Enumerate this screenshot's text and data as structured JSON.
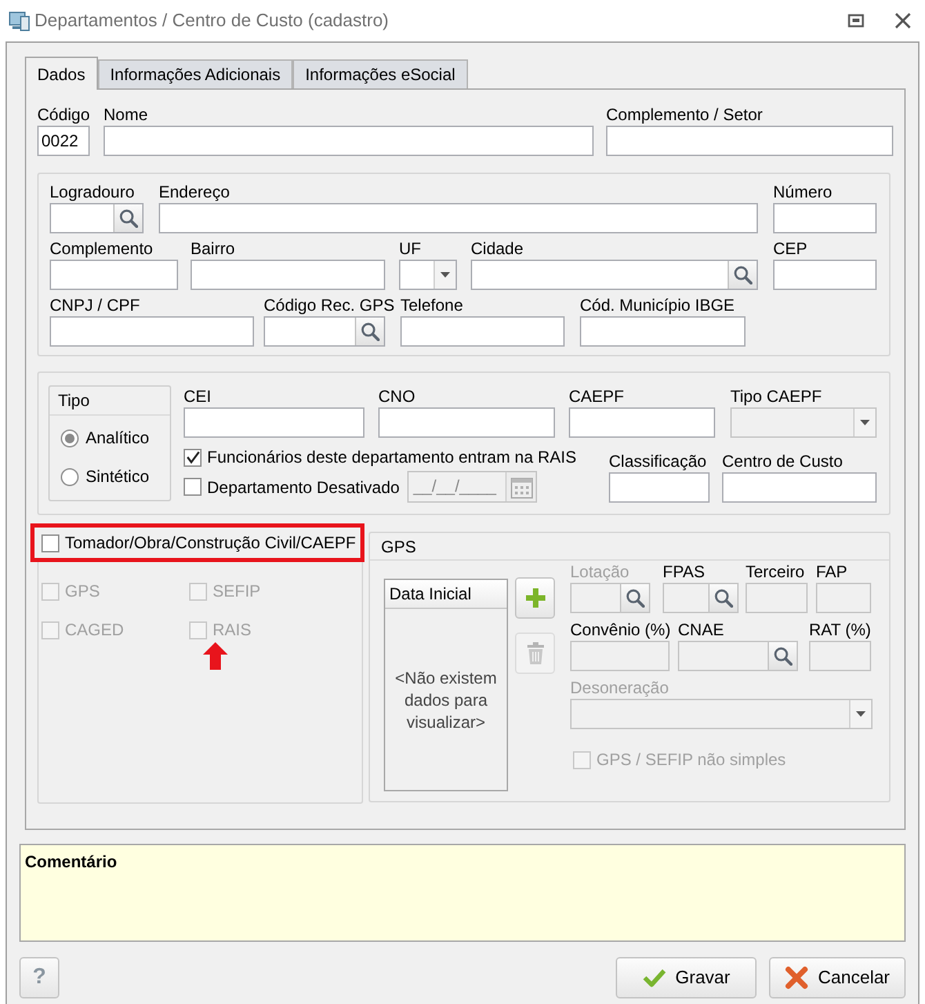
{
  "window": {
    "title": "Departamentos / Centro de Custo (cadastro)"
  },
  "tabs": [
    {
      "label": "Dados",
      "selected": true
    },
    {
      "label": "Informações Adicionais",
      "selected": false
    },
    {
      "label": "Informações eSocial",
      "selected": false
    }
  ],
  "identification": [
    {
      "label": "Código",
      "kind": "text",
      "value": "0022"
    },
    {
      "label": "Nome",
      "kind": "text"
    },
    {
      "label": "Complemento / Setor",
      "kind": "text"
    }
  ],
  "address_rows": [
    [
      {
        "label": "Logradouro",
        "kind": "search"
      },
      {
        "label": "Endereço",
        "kind": "text"
      },
      {
        "label": "Número",
        "kind": "text"
      }
    ],
    [
      {
        "label": "Complemento",
        "kind": "text"
      },
      {
        "label": "Bairro",
        "kind": "text"
      },
      {
        "label": "UF",
        "kind": "dropdown"
      },
      {
        "label": "Cidade",
        "kind": "search"
      },
      {
        "label": "CEP",
        "kind": "text"
      }
    ],
    [
      {
        "label": "CNPJ / CPF",
        "kind": "text"
      },
      {
        "label": "Código Rec. GPS",
        "kind": "search"
      },
      {
        "label": "Telefone",
        "kind": "text"
      },
      {
        "label": "Cód. Município IBGE",
        "kind": "text"
      }
    ]
  ],
  "tipo": {
    "title": "Tipo",
    "options": [
      {
        "label": "Analítico",
        "selected": true
      },
      {
        "label": "Sintético",
        "selected": false
      }
    ]
  },
  "registration_fields": [
    {
      "label": "CEI",
      "kind": "text"
    },
    {
      "label": "CNO",
      "kind": "text"
    },
    {
      "label": "CAEPF",
      "kind": "text"
    },
    {
      "label": "Tipo CAEPF",
      "kind": "dropdown",
      "readonly": true
    }
  ],
  "rais_checkbox": {
    "label": "Funcionários deste departamento entram na RAIS",
    "checked": true
  },
  "deactivated": {
    "label": "Departamento Desativado",
    "checked": false,
    "date": {
      "kind": "date",
      "value": "__/__/____",
      "readonly": true
    }
  },
  "cost_fields": [
    {
      "label": "Classificação",
      "kind": "text"
    },
    {
      "label": "Centro de Custo",
      "kind": "text"
    }
  ],
  "tomador": {
    "label": "Tomador/Obra/Construção Civil/CAEPF",
    "checked": false,
    "highlighted": true
  },
  "obligations": [
    {
      "label": "GPS",
      "checked": false,
      "disabled": true,
      "arrow": false
    },
    {
      "label": "SEFIP",
      "checked": false,
      "disabled": true,
      "arrow": false
    },
    {
      "label": "CAGED",
      "checked": false,
      "disabled": true,
      "arrow": false
    },
    {
      "label": "RAIS",
      "checked": false,
      "disabled": true,
      "arrow": true
    }
  ],
  "gps": {
    "title": "GPS",
    "list_column": "Data Inicial",
    "empty_text": "<Não existem dados para visualizar>",
    "buttons": [
      {
        "kind": "add",
        "disabled": false
      },
      {
        "kind": "delete",
        "disabled": true
      }
    ],
    "field_rows": [
      [
        {
          "label": "Lotação",
          "kind": "search",
          "disabled": true
        },
        {
          "label": "FPAS",
          "kind": "search",
          "readonly": true
        },
        {
          "label": "Terceiro",
          "kind": "text",
          "readonly": true
        },
        {
          "label": "FAP",
          "kind": "text",
          "readonly": true
        }
      ],
      [
        {
          "label": "Convênio (%)",
          "kind": "text",
          "readonly": true
        },
        {
          "label": "CNAE",
          "kind": "search",
          "readonly": true
        },
        {
          "label": "RAT (%)",
          "kind": "text",
          "readonly": true
        }
      ],
      [
        {
          "label": "Desoneração",
          "kind": "dropdown",
          "disabled": true
        }
      ]
    ],
    "simple_checkbox": {
      "label": "GPS / SEFIP não simples",
      "checked": false,
      "disabled": true
    }
  },
  "comment": {
    "label": "Comentário"
  },
  "footer": {
    "help": "?",
    "buttons": [
      {
        "kind": "save",
        "label": "Gravar"
      },
      {
        "kind": "cancel",
        "label": "Cancelar"
      }
    ]
  }
}
